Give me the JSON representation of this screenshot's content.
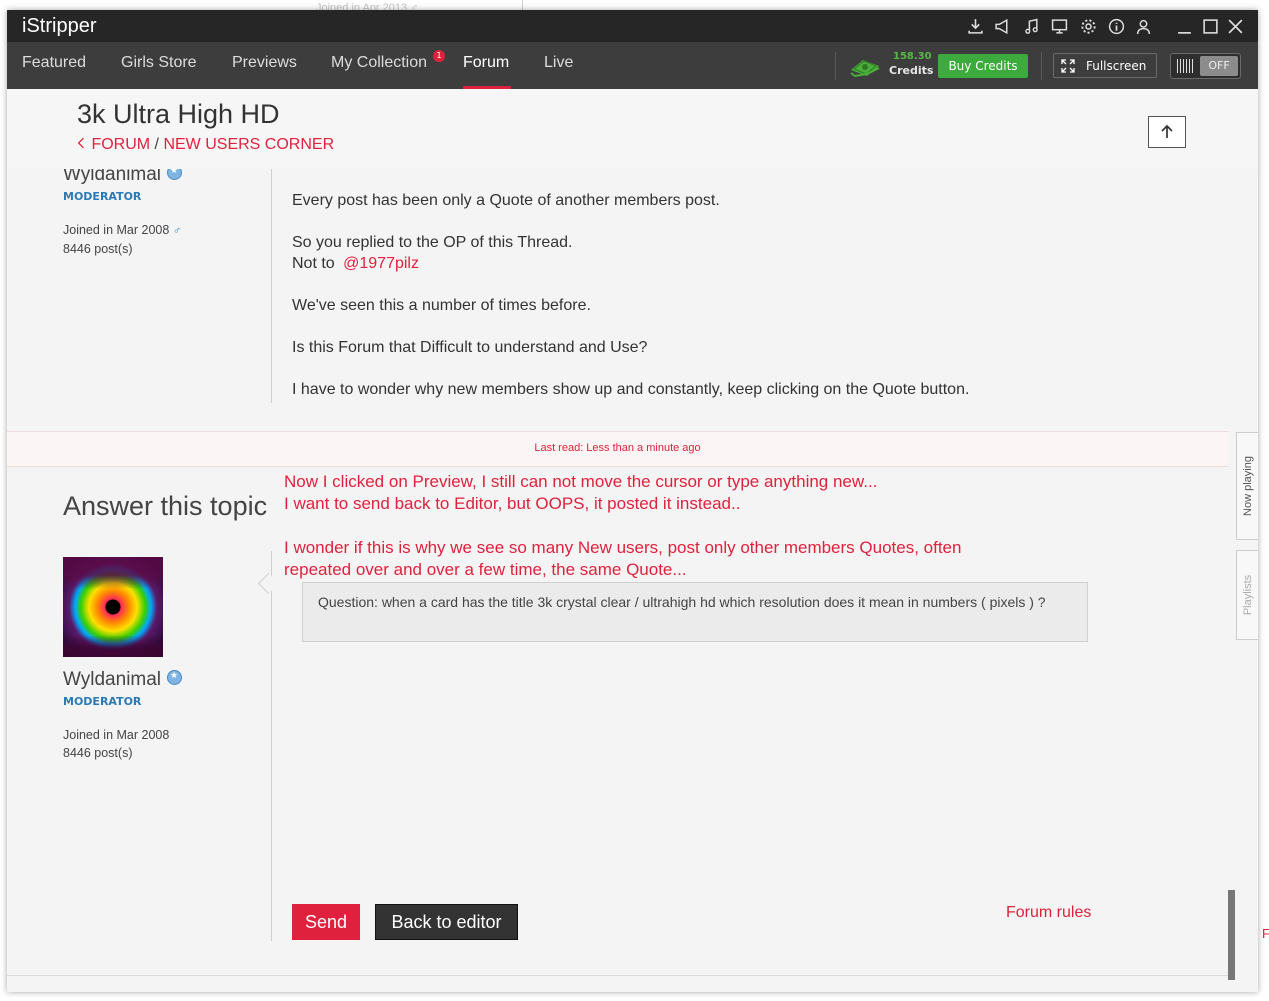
{
  "app": {
    "title": "iStripper"
  },
  "background": {
    "faint_text": "Joined in Apr 2013 ♂",
    "edge_text": "F"
  },
  "nav": {
    "items": [
      "Featured",
      "Girls Store",
      "Previews",
      "My Collection",
      "Forum",
      "Live"
    ],
    "active": "Forum",
    "collection_badge": "1",
    "credits_amount": "158.30",
    "credits_label": "Credits",
    "buy_credits": "Buy Credits",
    "fullscreen": "Fullscreen",
    "toggle_state": "OFF"
  },
  "header": {
    "title": "3k Ultra High HD",
    "breadcrumb_forum": "FORUM",
    "breadcrumb_sep": " / ",
    "breadcrumb_section": "NEW USERS CORNER"
  },
  "post": {
    "author": "Wyldanimal",
    "role": "MODERATOR",
    "joined": "Joined in Mar 2008",
    "posts": "8446 post(s)",
    "lines": [
      "Every post has been only a Quote of another members post.",
      "So you replied to the OP of this Thread.",
      "Not to",
      "@1977pilz",
      "We've seen this a number of times before.",
      "Is this Forum that Difficult to understand and Use?",
      "I have to wonder why new members show up and constantly, keep clicking on the Quote button."
    ]
  },
  "last_read": "Last read: Less than a minute ago",
  "answer": {
    "title": "Answer this topic",
    "author": "Wyldanimal",
    "role": "MODERATOR",
    "joined": "Joined in Mar 2008",
    "posts": "8446 post(s)",
    "quote": "Question: when a card has the title 3k crystal clear / ultrahigh hd which resolution does it mean in numbers ( pixels ) ?",
    "send": "Send",
    "back_to_editor": "Back to editor",
    "forum_rules": "Forum rules"
  },
  "annotation": {
    "line1": "Now I clicked on Preview,  I still can not move the cursor or type anything new...",
    "line2": "I want to send back to Editor, but OOPS,  it posted it instead..",
    "line3": "I wonder if this is why we see so many New users,  post only other members Quotes,  often",
    "line4": "repeated over and over a few time, the same Quote..."
  },
  "side_tabs": {
    "now_playing": "Now playing",
    "playlists": "Playlists"
  },
  "colors": {
    "accent": "#e0213d",
    "green": "#3caa3c",
    "titlebar": "#262626",
    "navbar": "#3d3d3d"
  }
}
